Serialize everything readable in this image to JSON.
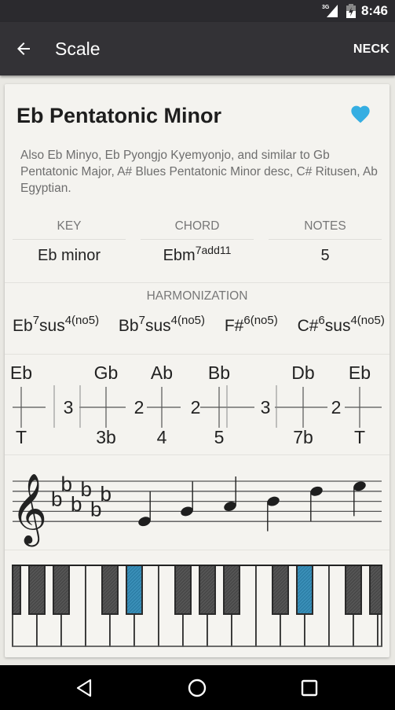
{
  "status_bar": {
    "network": "3G",
    "time": "8:46"
  },
  "app_bar": {
    "title": "Scale",
    "action": "NECK",
    "back_icon": "arrow-back-icon"
  },
  "scale": {
    "name": "Eb Pentatonic Minor",
    "favorite": true,
    "description": "Also Eb Minyo, Eb Pyongjo Kyemyonjo, and similar to Gb Pentatonic Major, A# Blues Pentatonic Minor desc, C# Ritusen, Ab Egyptian."
  },
  "info": {
    "key": {
      "label": "KEY",
      "value": "Eb minor"
    },
    "chord": {
      "label": "CHORD",
      "value_base": "Ebm",
      "value_sup": "7add11"
    },
    "notes": {
      "label": "NOTES",
      "value": "5"
    }
  },
  "harmonization": {
    "label": "HARMONIZATION",
    "chords": [
      {
        "root": "Eb",
        "sup1": "7",
        "mid": "sus",
        "sup2": "4(no5)"
      },
      {
        "root": "Bb",
        "sup1": "7",
        "mid": "sus",
        "sup2": "4(no5)"
      },
      {
        "root": "F#",
        "sup1": "6(no5)",
        "mid": "",
        "sup2": ""
      },
      {
        "root": "C#",
        "sup1": "6",
        "mid": "sus",
        "sup2": "4(no5)"
      }
    ]
  },
  "intervals": {
    "notes": [
      "Eb",
      "Gb",
      "Ab",
      "Bb",
      "Db",
      "Eb"
    ],
    "degrees": [
      "T",
      "3b",
      "4",
      "5",
      "7b",
      "T"
    ],
    "steps": [
      "3",
      "2",
      "2",
      "3",
      "2"
    ]
  },
  "staff": {
    "clef": "treble",
    "key_signature_flats": 6,
    "notes": [
      "Eb4",
      "Gb4",
      "Ab4",
      "Bb4",
      "Db5",
      "Eb5"
    ]
  },
  "piano": {
    "first_white_key": "G",
    "white_key_count": 16,
    "highlighted": [
      "D#",
      "D#"
    ],
    "colors": {
      "highlight": "#2f8ab5",
      "black": "#4a4a4a",
      "white": "#f5f4f0"
    }
  },
  "colors": {
    "accent": "#35aee2",
    "appbar": "#333236",
    "statusbar": "#2b2a2e",
    "card": "#f4f3ef"
  },
  "nav": {
    "back": "nav-back-icon",
    "home": "nav-home-icon",
    "recents": "nav-recents-icon"
  }
}
